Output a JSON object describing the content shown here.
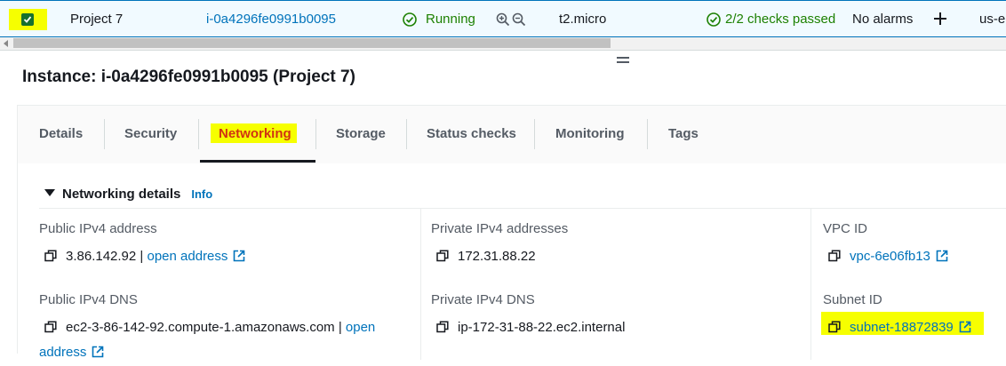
{
  "instance_row": {
    "name": "Project 7",
    "instance_id": "i-0a4296fe0991b0095",
    "state": "Running",
    "instance_type": "t2.micro",
    "status_check": "2/2 checks passed",
    "alarms": "No alarms",
    "zone_partial": "us-e"
  },
  "title": "Instance: i-0a4296fe0991b0095 (Project 7)",
  "tabs": [
    {
      "label": "Details"
    },
    {
      "label": "Security"
    },
    {
      "label": "Networking"
    },
    {
      "label": "Storage"
    },
    {
      "label": "Status checks"
    },
    {
      "label": "Monitoring"
    },
    {
      "label": "Tags"
    }
  ],
  "active_tab": "Networking",
  "networking": {
    "heading": "Networking details",
    "info_label": "Info",
    "public_ipv4": {
      "label": "Public IPv4 address",
      "value": "3.86.142.92",
      "separator": "|",
      "link": "open address"
    },
    "private_ipv4": {
      "label": "Private IPv4 addresses",
      "value": "172.31.88.22"
    },
    "vpc": {
      "label": "VPC ID",
      "value": "vpc-6e06fb13"
    },
    "public_dns": {
      "label": "Public IPv4 DNS",
      "value": "ec2-3-86-142-92.compute-1.amazonaws.com",
      "separator": "|",
      "link_line1": "open",
      "link_line2": "address"
    },
    "private_dns": {
      "label": "Private IPv4 DNS",
      "value": "ip-172-31-88-22.ec2.internal"
    },
    "subnet": {
      "label": "Subnet ID",
      "value": "subnet-18872839"
    }
  },
  "colors": {
    "accent": "#0073bb",
    "success": "#1d8102",
    "highlight": "#f6ff00",
    "active_tab_text": "#d13212"
  }
}
